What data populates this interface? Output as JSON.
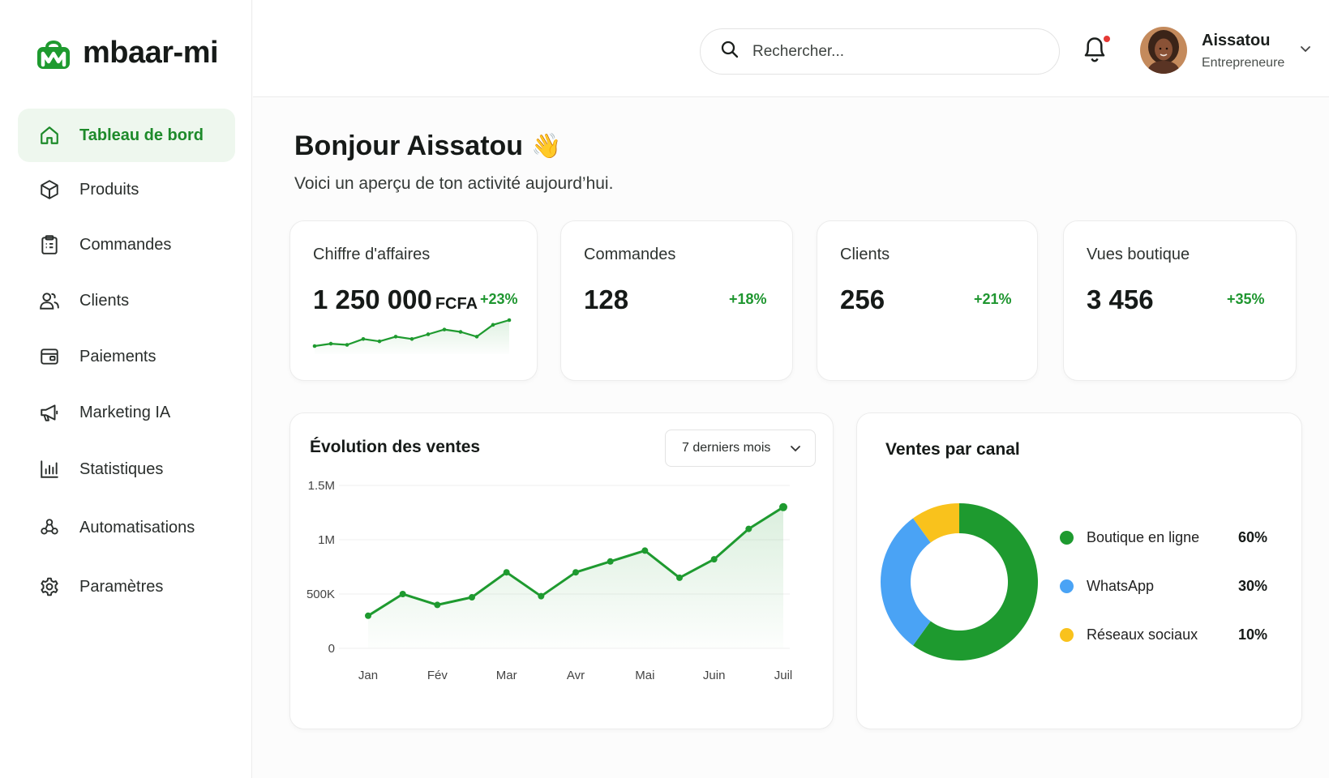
{
  "brand": {
    "name": "mbaar-mi",
    "accent": "#1e9a2f"
  },
  "sidebar": {
    "items": [
      {
        "label": "Tableau de bord",
        "icon": "home-icon",
        "active": true
      },
      {
        "label": "Produits",
        "icon": "box-icon"
      },
      {
        "label": "Commandes",
        "icon": "clipboard-icon"
      },
      {
        "label": "Clients",
        "icon": "users-icon"
      },
      {
        "label": "Paiements",
        "icon": "wallet-icon"
      },
      {
        "label": "Marketing IA",
        "icon": "megaphone-icon"
      },
      {
        "label": "Statistiques",
        "icon": "bar-chart-icon"
      },
      {
        "label": "Automatisations",
        "icon": "automation-icon"
      },
      {
        "label": "Paramètres",
        "icon": "gear-icon"
      }
    ]
  },
  "topbar": {
    "search_placeholder": "Rechercher...",
    "notifications_unread": true,
    "user": {
      "name": "Aissatou",
      "role": "Entrepreneure"
    }
  },
  "main": {
    "greeting": "Bonjour Aissatou",
    "greeting_emoji": "👋",
    "subtitle": "Voici un aperçu de ton activité aujourd’hui."
  },
  "kpis": [
    {
      "label": "Chiffre d'affaires",
      "value": "1 250 000",
      "unit": "FCFA",
      "delta": "+23%"
    },
    {
      "label": "Commandes",
      "value": "128",
      "delta": "+18%"
    },
    {
      "label": "Clients",
      "value": "256",
      "delta": "+21%"
    },
    {
      "label": "Vues boutique",
      "value": "3 456",
      "delta": "+35%"
    }
  ],
  "sales_panel": {
    "title": "Évolution des ventes",
    "period": "7 derniers mois"
  },
  "channel_panel": {
    "title": "Ventes par canal"
  },
  "chart_data": [
    {
      "type": "line",
      "x": [
        "Jan",
        "Fév",
        "Mar",
        "Avr",
        "Mai",
        "Juin",
        "Juil"
      ],
      "x_points": [
        0,
        0.5,
        1,
        1.5,
        2,
        2.5,
        3,
        3.5,
        4,
        4.5,
        5,
        5.5,
        6
      ],
      "values": [
        300000,
        500000,
        400000,
        470000,
        700000,
        480000,
        700000,
        800000,
        900000,
        650000,
        820000,
        1100000,
        1300000
      ],
      "y_ticks": [
        "1.5M",
        "1M",
        "500K",
        "0"
      ],
      "ylim": [
        0,
        1500000
      ],
      "grid": true,
      "color": "#1e9a2f"
    },
    {
      "type": "pie",
      "donut": true,
      "labels": [
        "Boutique en ligne",
        "WhatsApp",
        "Réseaux sociaux"
      ],
      "values": [
        60,
        30,
        10
      ],
      "value_labels": [
        "60%",
        "30%",
        "10%"
      ],
      "colors": [
        "#1e9a2f",
        "#4aa3f5",
        "#f9c21c"
      ]
    },
    {
      "type": "line",
      "sparkline": true,
      "values": [
        3,
        4,
        3.5,
        6,
        5,
        7,
        6,
        8,
        10,
        9,
        7,
        12,
        14
      ],
      "color": "#1e9a2f"
    }
  ]
}
